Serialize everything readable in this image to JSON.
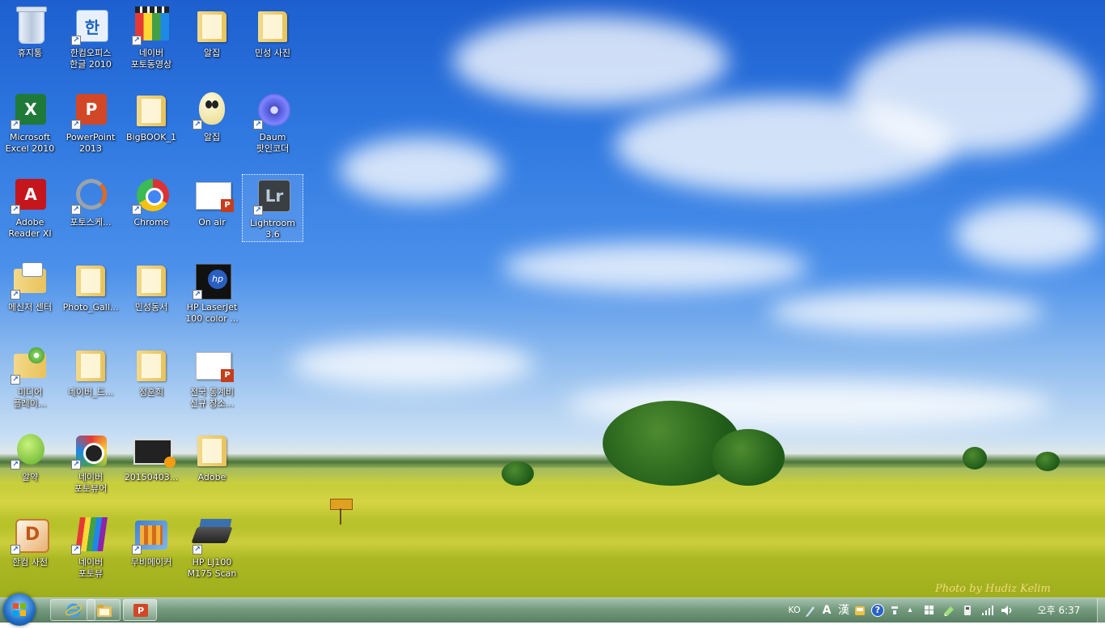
{
  "desktop": {
    "icons": [
      {
        "label": "휴지통"
      },
      {
        "label": "한컴오피스\n한글 2010"
      },
      {
        "label": "네이버\n포토동영상"
      },
      {
        "label": "알집"
      },
      {
        "label": "민성 사진"
      },
      {
        "label": "Microsoft\nExcel 2010"
      },
      {
        "label": "PowerPoint\n2013"
      },
      {
        "label": "BigBOOK_1"
      },
      {
        "label": "알집"
      },
      {
        "label": "Daum\n팟인코더"
      },
      {
        "label": "Adobe\nReader XI"
      },
      {
        "label": "포토스케..."
      },
      {
        "label": "Chrome"
      },
      {
        "label": "On air"
      },
      {
        "label": "Lightroom\n3.6"
      },
      {
        "label": "메신저 센터"
      },
      {
        "label": "Photo_Gall..."
      },
      {
        "label": "민성동서"
      },
      {
        "label": "HP LaserJet\n100 color ..."
      },
      {
        "label": "미디어\n플레이..."
      },
      {
        "label": "네이버_드..."
      },
      {
        "label": "정훈희"
      },
      {
        "label": "전국 통계비\n신규 창소..."
      },
      {
        "label": "알약"
      },
      {
        "label": "네이버\n포토뷰어"
      },
      {
        "label": "20150403..."
      },
      {
        "label": "Adobe"
      },
      {
        "label": "한컴 사전"
      },
      {
        "label": "네이버\n포토뷰"
      },
      {
        "label": "무비메이커"
      },
      {
        "label": "HP LJ100\nM175 Scan"
      }
    ],
    "watermark": "Photo by Hudiz Kelim"
  },
  "taskbar": {
    "tray": {
      "lang": "KO",
      "ime_a": "A",
      "ime_han": "漢",
      "help": "?",
      "arrow": "▴"
    },
    "clock": "오후 6:37"
  }
}
